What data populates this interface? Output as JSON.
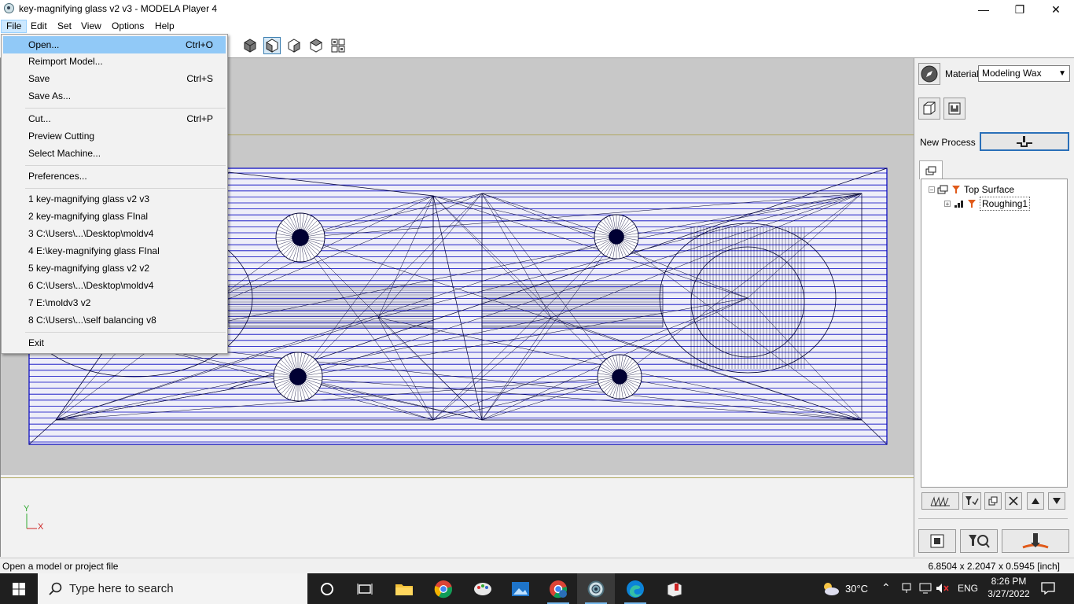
{
  "window": {
    "title": "key-magnifying glass v2 v3 - MODELA Player 4",
    "controls": {
      "minimize": "—",
      "maximize": "❐",
      "close": "✕"
    }
  },
  "menubar": [
    "File",
    "Edit",
    "Set",
    "View",
    "Options",
    "Help"
  ],
  "file_menu": {
    "items": [
      {
        "label": "Open...",
        "shortcut": "Ctrl+O",
        "highlighted": true
      },
      {
        "label": "Reimport Model...",
        "shortcut": ""
      },
      {
        "label": "Save",
        "shortcut": "Ctrl+S"
      },
      {
        "label": "Save As...",
        "shortcut": ""
      },
      {
        "label": "Cut...",
        "shortcut": "Ctrl+P"
      },
      {
        "label": "Preview Cutting",
        "shortcut": ""
      },
      {
        "label": "Select Machine...",
        "shortcut": ""
      },
      {
        "label": "Preferences...",
        "shortcut": ""
      },
      {
        "label": "1 key-magnifying glass v2 v3",
        "shortcut": ""
      },
      {
        "label": "2 key-magnifying glass FInal",
        "shortcut": ""
      },
      {
        "label": "3 C:\\Users\\...\\Desktop\\moldv4",
        "shortcut": ""
      },
      {
        "label": "4 E:\\key-magnifying glass FInal",
        "shortcut": ""
      },
      {
        "label": "5 key-magnifying glass v2 v2",
        "shortcut": ""
      },
      {
        "label": "6 C:\\Users\\...\\Desktop\\moldv4",
        "shortcut": ""
      },
      {
        "label": "7 E:\\moldv3 v2",
        "shortcut": ""
      },
      {
        "label": "8 C:\\Users\\...\\self balancing v8",
        "shortcut": ""
      },
      {
        "label": "Exit",
        "shortcut": ""
      }
    ]
  },
  "viewport": {
    "axis_y": "Y",
    "axis_x": "X"
  },
  "right_panel": {
    "material_label": "Material",
    "material_value": "Modeling Wax",
    "new_process_label": "New Process",
    "tree": [
      {
        "label": "Top Surface"
      },
      {
        "label": "Roughing1"
      }
    ]
  },
  "status": {
    "message": "Open a model or project file",
    "dimensions": "6.8504 x 2.2047 x 0.5945 [inch]"
  },
  "taskbar": {
    "search_placeholder": "Type here to search",
    "weather": "30°C",
    "language": "ENG",
    "time": "8:26 PM",
    "date": "3/27/2022"
  },
  "colors": {
    "highlight": "#91c9f7",
    "mesh_fill": "#eeeef8",
    "mesh_border": "#0000c0",
    "mesh_line": "#000033"
  }
}
